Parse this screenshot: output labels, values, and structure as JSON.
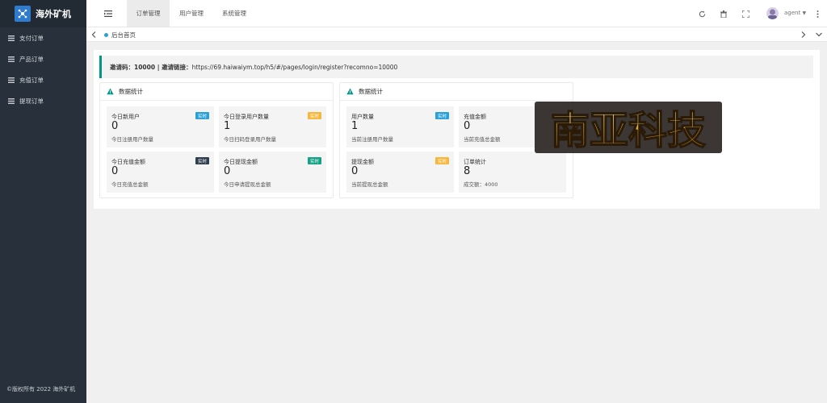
{
  "app": {
    "logo_text": "海外矿机",
    "footer": "©版权所有 2022 海外矿机"
  },
  "sidebar": {
    "items": [
      {
        "label": "支付订单"
      },
      {
        "label": "产品订单"
      },
      {
        "label": "充值订单"
      },
      {
        "label": "提现订单"
      }
    ]
  },
  "header": {
    "tabs": [
      {
        "label": "订单管理",
        "active": true
      },
      {
        "label": "用户管理",
        "active": false
      },
      {
        "label": "系统管理",
        "active": false
      }
    ],
    "user": "agent"
  },
  "tabbar": {
    "tab": "后台首页"
  },
  "notice": {
    "prefix": "邀请码：",
    "code": "10000",
    "sep": " | ",
    "link_label": "邀请链接：",
    "url": "https://69.haiwaiym.top/h5/#/pages/login/register?recomno=10000"
  },
  "cards": [
    {
      "title": "数据统计",
      "stats": [
        {
          "label": "今日新用户",
          "value": "0",
          "sub": "今日注册用户数量",
          "badge": "实时",
          "badge_color": "#2aa0d8"
        },
        {
          "label": "今日登录用户数量",
          "value": "1",
          "sub": "今日扫码登录用户数量",
          "badge": "实时",
          "badge_color": "#f6b73c"
        },
        {
          "label": "今日充值金额",
          "value": "0",
          "sub": "今日充值总金额",
          "badge": "实时",
          "badge_color": "#2f3e4e"
        },
        {
          "label": "今日提现金额",
          "value": "0",
          "sub": "今日申请提现总金额",
          "badge": "实时",
          "badge_color": "#16a085"
        }
      ]
    },
    {
      "title": "数据统计",
      "stats": [
        {
          "label": "用户数量",
          "value": "1",
          "sub": "当前注册用户数量",
          "badge": "实时",
          "badge_color": "#2aa0d8"
        },
        {
          "label": "充值金额",
          "value": "0",
          "sub": "当前充值总金额",
          "badge": "",
          "badge_color": ""
        },
        {
          "label": "提现金额",
          "value": "0",
          "sub": "当前提现总金额",
          "badge": "实时",
          "badge_color": "#f6b73c"
        },
        {
          "label": "订单统计",
          "value": "8",
          "sub": "成交额：4000",
          "badge": "",
          "badge_color": ""
        }
      ]
    }
  ],
  "colors": {
    "sidebar": "#28313b",
    "accent": "#009688",
    "warn": "#009688"
  },
  "watermark": {
    "text": "南亚科技"
  }
}
